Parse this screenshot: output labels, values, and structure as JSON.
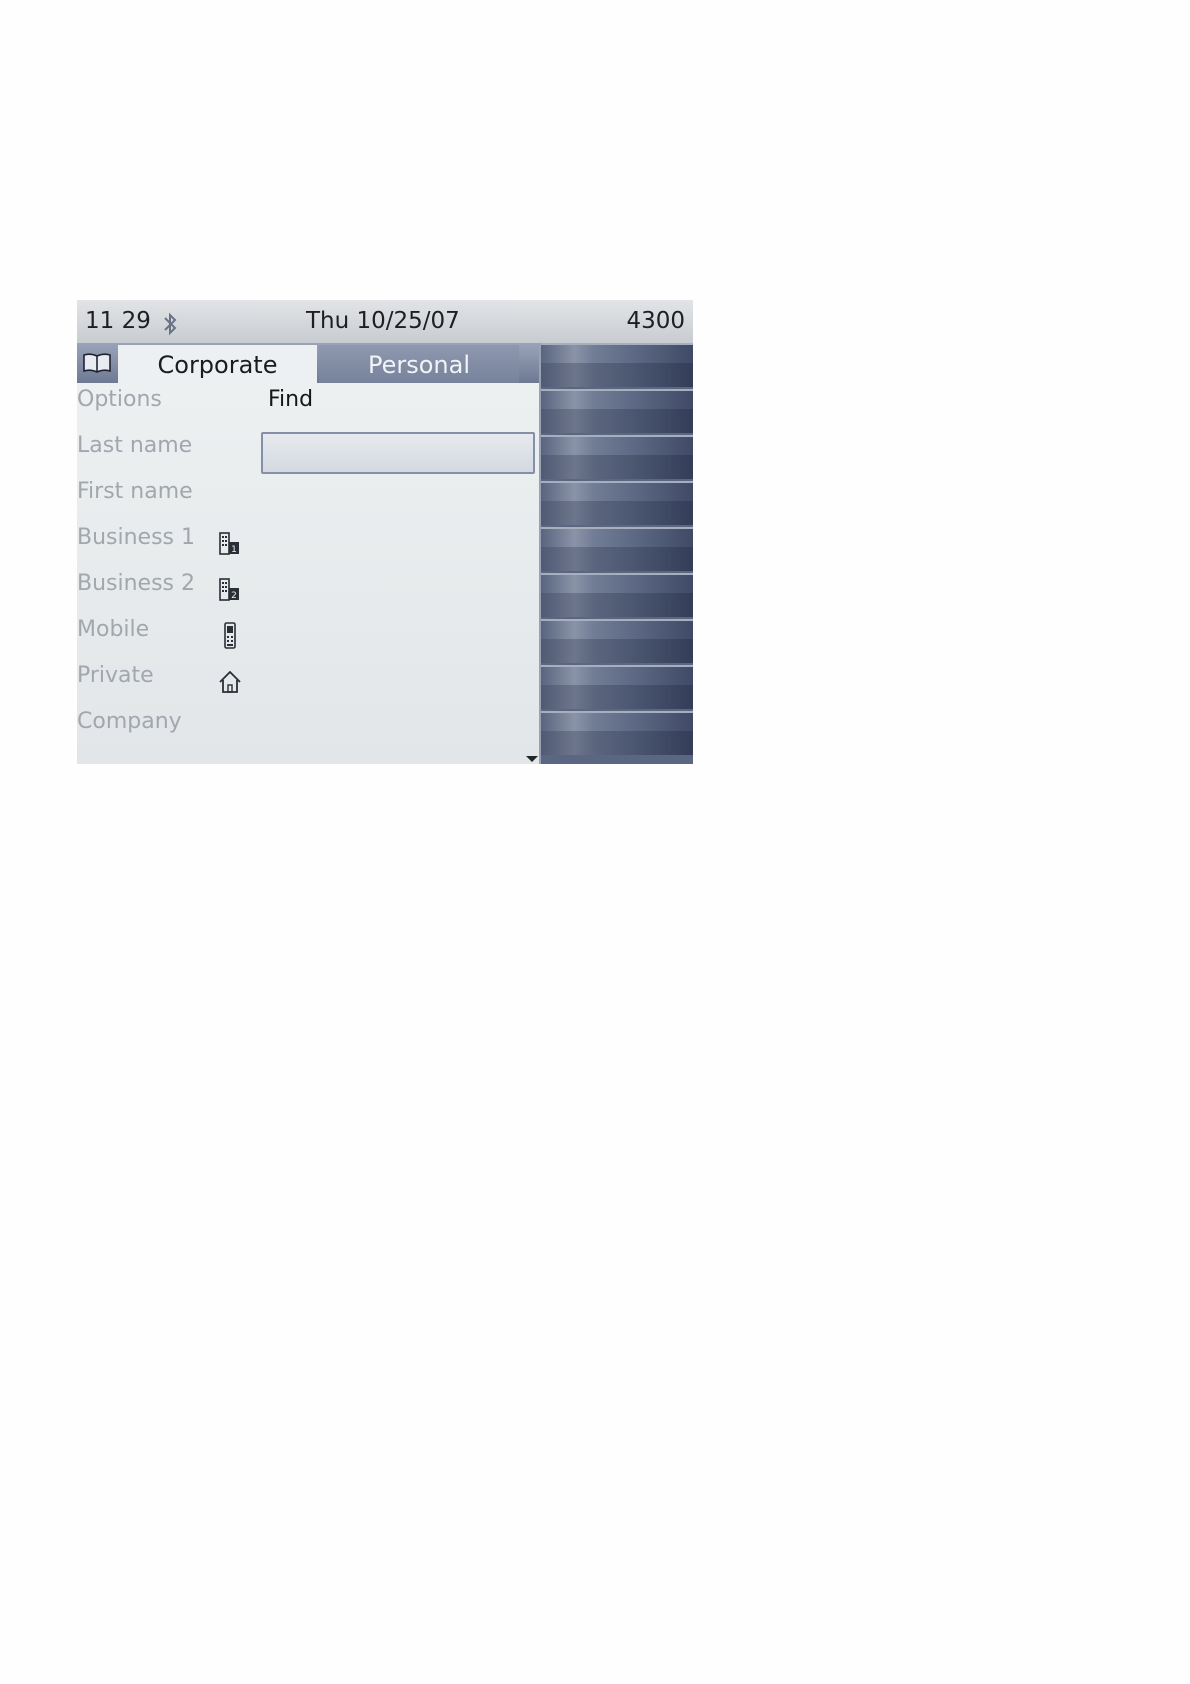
{
  "status_bar": {
    "time": "11 29",
    "date": "Thu 10/25/07",
    "extension": "4300",
    "bluetooth_icon": "bluetooth-icon"
  },
  "tabs": [
    {
      "label": "Corporate",
      "selected": true
    },
    {
      "label": "Personal",
      "selected": false
    }
  ],
  "form": {
    "options_label": "Options",
    "find_label": "Find",
    "last_name": {
      "label": "Last name",
      "value": ""
    },
    "first_name": {
      "label": "First name"
    },
    "business1": {
      "label": "Business 1",
      "icon": "building-1-icon"
    },
    "business2": {
      "label": "Business 2",
      "icon": "building-2-icon"
    },
    "mobile": {
      "label": "Mobile",
      "icon": "mobile-phone-icon"
    },
    "private": {
      "label": "Private",
      "icon": "home-icon"
    },
    "company": {
      "label": "Company"
    }
  },
  "colors": {
    "softkey_panel": "#5b6782",
    "tab_active": "#ecf0f2",
    "tab_inactive": "#8e98ae"
  }
}
